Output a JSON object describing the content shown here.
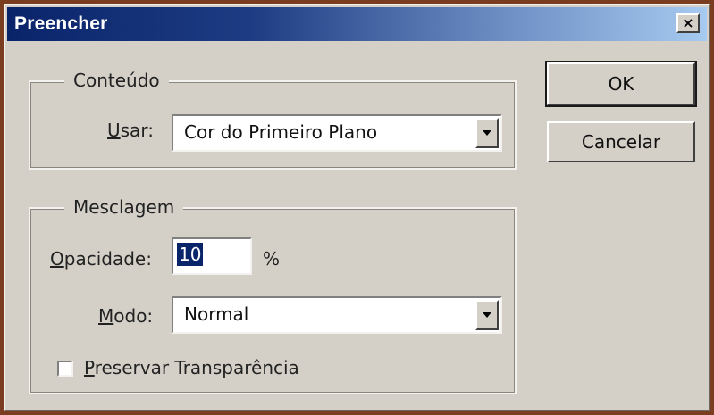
{
  "window": {
    "title": "Preencher",
    "close_label": "×"
  },
  "conteudo": {
    "legend": "Conteúdo",
    "usar_label_mnemonic": "U",
    "usar_label_rest": "sar:",
    "usar_value": "Cor do Primeiro Plano"
  },
  "mesclagem": {
    "legend": "Mesclagem",
    "opacidade_label_mnemonic": "O",
    "opacidade_label_rest": "pacidade:",
    "opacidade_value": "10",
    "percent_label": "%",
    "modo_label_mnemonic": "M",
    "modo_label_rest": "odo:",
    "modo_value": "Normal",
    "preservar_label_mnemonic": "P",
    "preservar_label_rest": "reservar Transparência",
    "preservar_checked": false
  },
  "buttons": {
    "ok_label": "OK",
    "cancel_label": "Cancelar"
  }
}
